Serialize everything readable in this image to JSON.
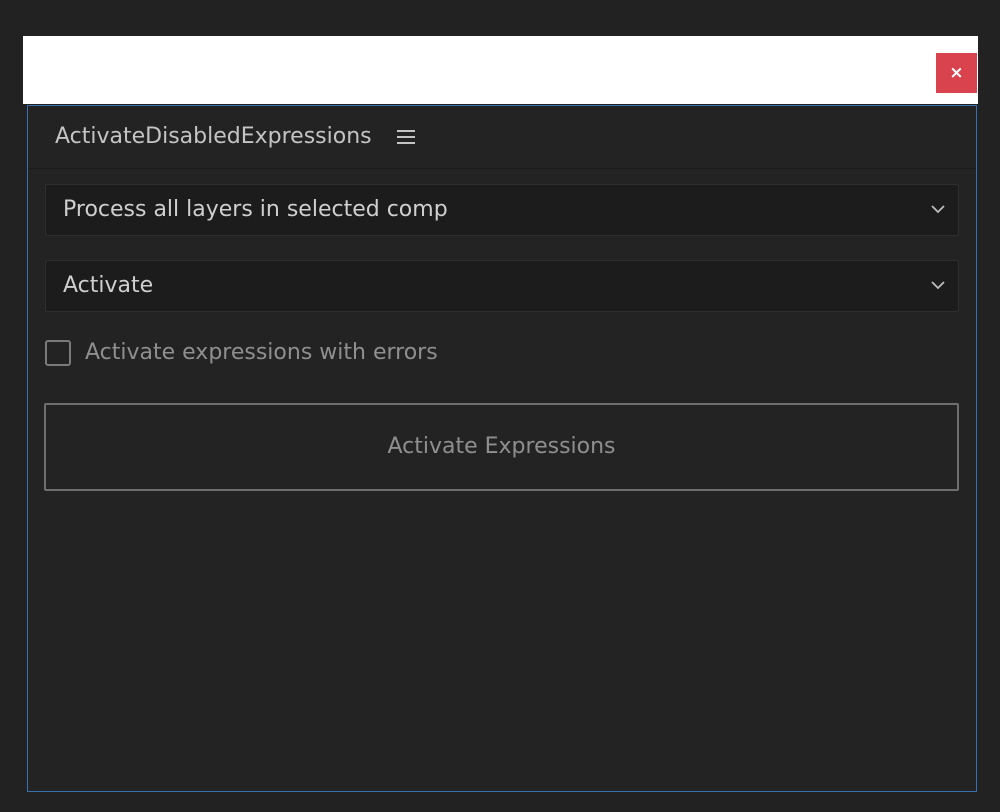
{
  "window": {
    "close_label": "×"
  },
  "panel": {
    "title": "ActivateDisabledExpressions",
    "menu_icon": "hamburger-menu-icon"
  },
  "controls": {
    "scope_dropdown": {
      "selected": "Process all layers in selected comp"
    },
    "mode_dropdown": {
      "selected": "Activate"
    },
    "errors_checkbox": {
      "label": "Activate expressions with errors",
      "checked": false
    },
    "action_button": {
      "label": "Activate Expressions"
    }
  },
  "colors": {
    "close_button": "#d9434e",
    "panel_border": "#3a6fb0",
    "background": "#222222"
  }
}
